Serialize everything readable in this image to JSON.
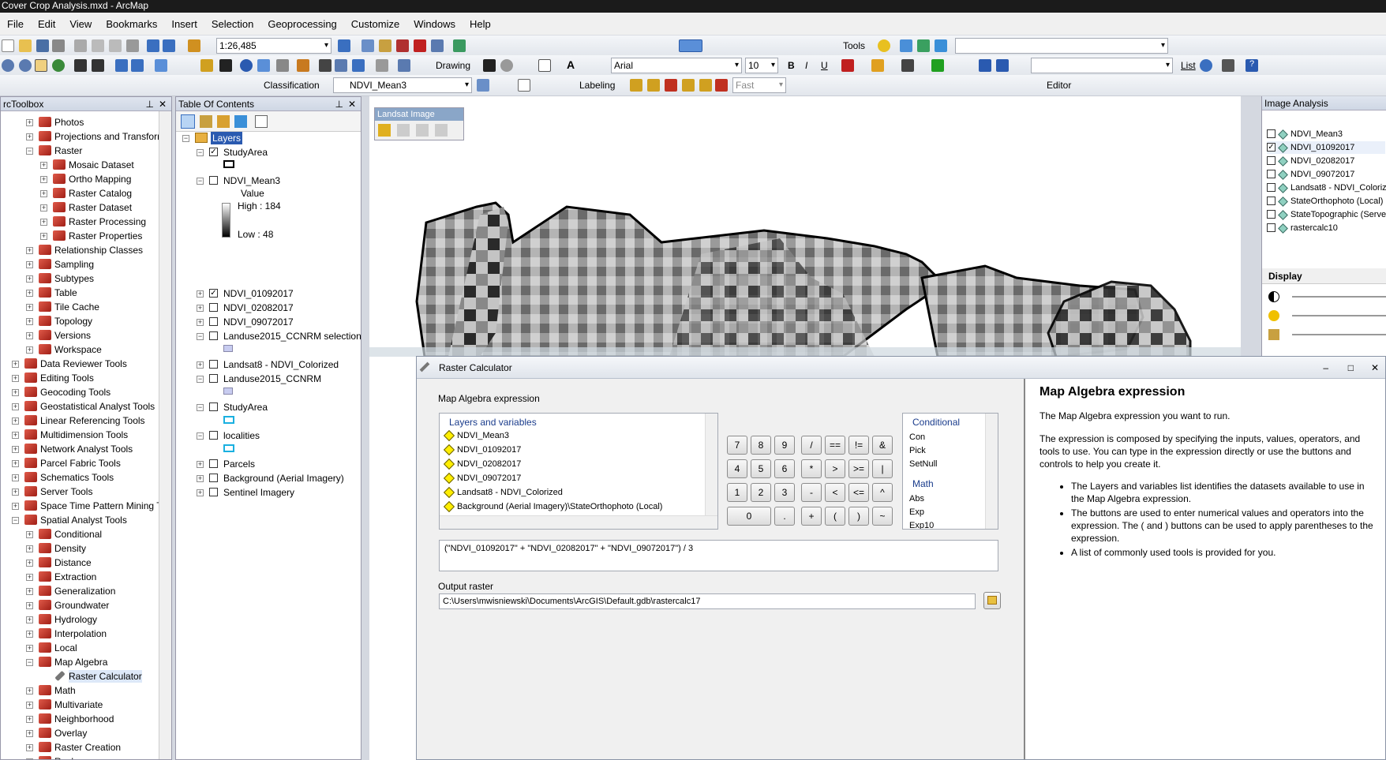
{
  "app": {
    "title": "Cover Crop Analysis.mxd - ArcMap"
  },
  "menu": [
    "File",
    "Edit",
    "View",
    "Bookmarks",
    "Insert",
    "Selection",
    "Geoprocessing",
    "Customize",
    "Windows",
    "Help"
  ],
  "toolbar": {
    "scale": "1:26,485",
    "tools_label": "Tools",
    "drawing_label": "Drawing",
    "font": "Arial",
    "font_size": "10",
    "classification_label": "Classification",
    "layer_combo": "NDVI_Mean3",
    "labeling_label": "Labeling",
    "fast_combo": "Fast",
    "editor_label": "Editor",
    "list_label": "List",
    "bold": "B",
    "italic": "I",
    "underline": "U"
  },
  "toolbox": {
    "title": "rcToolbox",
    "items": [
      {
        "label": "Photos",
        "indent": 1,
        "exp": "+"
      },
      {
        "label": "Projections and Transformat",
        "indent": 1,
        "exp": "+"
      },
      {
        "label": "Raster",
        "indent": 1,
        "exp": "−"
      },
      {
        "label": "Mosaic Dataset",
        "indent": 2,
        "exp": "+"
      },
      {
        "label": "Ortho Mapping",
        "indent": 2,
        "exp": "+"
      },
      {
        "label": "Raster Catalog",
        "indent": 2,
        "exp": "+"
      },
      {
        "label": "Raster Dataset",
        "indent": 2,
        "exp": "+"
      },
      {
        "label": "Raster Processing",
        "indent": 2,
        "exp": "+"
      },
      {
        "label": "Raster Properties",
        "indent": 2,
        "exp": "+"
      },
      {
        "label": "Relationship Classes",
        "indent": 1,
        "exp": "+"
      },
      {
        "label": "Sampling",
        "indent": 1,
        "exp": "+"
      },
      {
        "label": "Subtypes",
        "indent": 1,
        "exp": "+"
      },
      {
        "label": "Table",
        "indent": 1,
        "exp": "+"
      },
      {
        "label": "Tile Cache",
        "indent": 1,
        "exp": "+"
      },
      {
        "label": "Topology",
        "indent": 1,
        "exp": "+"
      },
      {
        "label": "Versions",
        "indent": 1,
        "exp": "+"
      },
      {
        "label": "Workspace",
        "indent": 1,
        "exp": "+"
      },
      {
        "label": "Data Reviewer Tools",
        "indent": 0,
        "exp": "+"
      },
      {
        "label": "Editing Tools",
        "indent": 0,
        "exp": "+"
      },
      {
        "label": "Geocoding Tools",
        "indent": 0,
        "exp": "+"
      },
      {
        "label": "Geostatistical Analyst Tools",
        "indent": 0,
        "exp": "+"
      },
      {
        "label": "Linear Referencing Tools",
        "indent": 0,
        "exp": "+"
      },
      {
        "label": "Multidimension Tools",
        "indent": 0,
        "exp": "+"
      },
      {
        "label": "Network Analyst Tools",
        "indent": 0,
        "exp": "+"
      },
      {
        "label": "Parcel Fabric Tools",
        "indent": 0,
        "exp": "+"
      },
      {
        "label": "Schematics Tools",
        "indent": 0,
        "exp": "+"
      },
      {
        "label": "Server Tools",
        "indent": 0,
        "exp": "+"
      },
      {
        "label": "Space Time Pattern Mining Too",
        "indent": 0,
        "exp": "+"
      },
      {
        "label": "Spatial Analyst Tools",
        "indent": 0,
        "exp": "−"
      },
      {
        "label": "Conditional",
        "indent": 1,
        "exp": "+"
      },
      {
        "label": "Density",
        "indent": 1,
        "exp": "+"
      },
      {
        "label": "Distance",
        "indent": 1,
        "exp": "+"
      },
      {
        "label": "Extraction",
        "indent": 1,
        "exp": "+"
      },
      {
        "label": "Generalization",
        "indent": 1,
        "exp": "+"
      },
      {
        "label": "Groundwater",
        "indent": 1,
        "exp": "+"
      },
      {
        "label": "Hydrology",
        "indent": 1,
        "exp": "+"
      },
      {
        "label": "Interpolation",
        "indent": 1,
        "exp": "+"
      },
      {
        "label": "Local",
        "indent": 1,
        "exp": "+"
      },
      {
        "label": "Map Algebra",
        "indent": 1,
        "exp": "−"
      },
      {
        "label": "Raster Calculator",
        "indent": 2,
        "exp": "",
        "tool": true,
        "selected": true
      },
      {
        "label": "Math",
        "indent": 1,
        "exp": "+"
      },
      {
        "label": "Multivariate",
        "indent": 1,
        "exp": "+"
      },
      {
        "label": "Neighborhood",
        "indent": 1,
        "exp": "+"
      },
      {
        "label": "Overlay",
        "indent": 1,
        "exp": "+"
      },
      {
        "label": "Raster Creation",
        "indent": 1,
        "exp": "+"
      },
      {
        "label": "Reclass",
        "indent": 1,
        "exp": "+"
      }
    ]
  },
  "toc": {
    "title": "Table Of Contents",
    "root": "Layers",
    "layers": [
      {
        "label": "StudyArea",
        "checked": true,
        "exp": "−"
      },
      {
        "label": "NDVI_Mean3",
        "checked": false,
        "exp": "−"
      },
      {
        "label": "NDVI_01092017",
        "checked": true,
        "exp": "+"
      },
      {
        "label": "NDVI_02082017",
        "checked": false,
        "exp": "+"
      },
      {
        "label": "NDVI_09072017",
        "checked": false,
        "exp": "+"
      },
      {
        "label": "Landuse2015_CCNRM selection",
        "checked": false,
        "exp": "−"
      },
      {
        "label": "Landsat8 - NDVI_Colorized",
        "checked": false,
        "exp": "+"
      },
      {
        "label": "Landuse2015_CCNRM",
        "checked": false,
        "exp": "−"
      },
      {
        "label": "StudyArea",
        "checked": false,
        "exp": "−"
      },
      {
        "label": "localities",
        "checked": false,
        "exp": "−"
      },
      {
        "label": "Parcels",
        "checked": false,
        "exp": "+"
      },
      {
        "label": "Background (Aerial Imagery)",
        "checked": false,
        "exp": "+"
      },
      {
        "label": "Sentinel Imagery",
        "checked": false,
        "exp": "+"
      }
    ],
    "legend": {
      "value_label": "Value",
      "high": "High : 184",
      "low": "Low : 48"
    }
  },
  "landsat_toolbar": {
    "title": "Landsat Image"
  },
  "image_analysis": {
    "title": "Image Analysis",
    "layers": [
      {
        "label": "NDVI_Mean3",
        "checked": false
      },
      {
        "label": "NDVI_01092017",
        "checked": true
      },
      {
        "label": "NDVI_02082017",
        "checked": false
      },
      {
        "label": "NDVI_09072017",
        "checked": false
      },
      {
        "label": "Landsat8 - NDVI_Coloriz",
        "checked": false
      },
      {
        "label": "StateOrthophoto (Local)",
        "checked": false
      },
      {
        "label": "StateTopographic (Serve",
        "checked": false
      },
      {
        "label": "rastercalc10",
        "checked": false
      }
    ],
    "display_label": "Display"
  },
  "dialog": {
    "title": "Raster Calculator",
    "section_label": "Map Algebra expression",
    "layers_header": "Layers and variables",
    "layers": [
      "NDVI_Mean3",
      "NDVI_01092017",
      "NDVI_02082017",
      "NDVI_09072017",
      "Landsat8 - NDVI_Colorized",
      "Background (Aerial Imagery)\\StateOrthophoto (Local)"
    ],
    "buttons": [
      [
        "7",
        "8",
        "9",
        "/",
        "==",
        "!=",
        "&"
      ],
      [
        "4",
        "5",
        "6",
        "*",
        ">",
        ">=",
        "|"
      ],
      [
        "1",
        "2",
        "3",
        "-",
        "<",
        "<=",
        "^"
      ],
      [
        "0",
        ".",
        "+",
        "(",
        ")",
        "~"
      ]
    ],
    "conditional_header": "Conditional",
    "conditional": [
      "Con",
      "Pick",
      "SetNull"
    ],
    "math_header": "Math",
    "math": [
      "Abs",
      "Exp",
      "Exp10"
    ],
    "expression": "(\"NDVI_01092017\" + \"NDVI_02082017\" + \"NDVI_09072017\") / 3",
    "output_label": "Output raster",
    "output_value": "C:\\Users\\mwisniewski\\Documents\\ArcGIS\\Default.gdb\\rastercalc17"
  },
  "help": {
    "title": "Map Algebra expression",
    "p1": "The Map Algebra expression you want to run.",
    "p2": "The expression is composed by specifying the inputs, values, operators, and tools to use. You can type in the expression directly or use the buttons and controls to help you create it.",
    "bullets": [
      "The Layers and variables list identifies the datasets available to use in the Map Algebra expression.",
      "The buttons are used to enter numerical values and operators into the expression. The ( and ) buttons can be used to apply parentheses to the expression.",
      "A list of commonly used tools is provided for you."
    ]
  }
}
